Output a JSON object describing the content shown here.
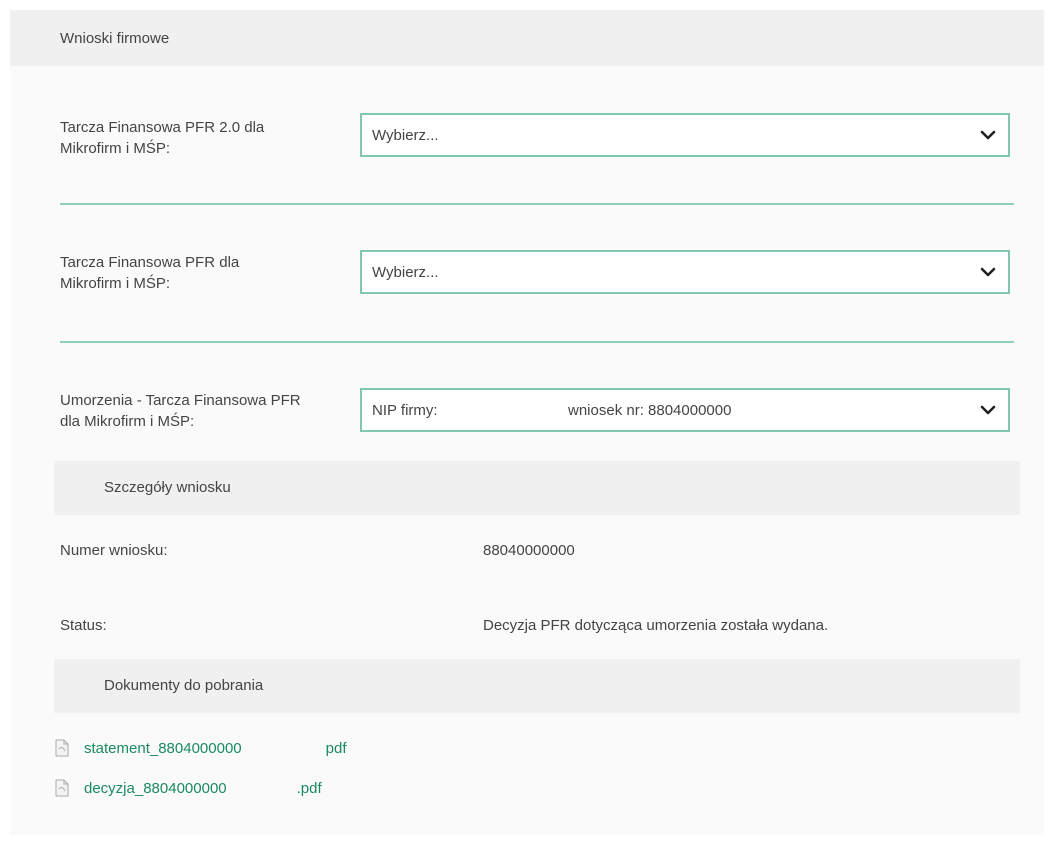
{
  "header": {
    "title": "Wnioski firmowe"
  },
  "fields": [
    {
      "label_line1": "Tarcza Finansowa PFR 2.0 dla",
      "label_line2": "Mikrofirm i MŚP:",
      "value": "Wybierz..."
    },
    {
      "label_line1": "Tarcza Finansowa PFR dla",
      "label_line2": "Mikrofirm i MŚP:",
      "value": "Wybierz..."
    },
    {
      "label_line1": "Umorzenia - Tarcza Finansowa PFR",
      "label_line2": "dla Mikrofirm i MŚP:",
      "value_nip": "NIP firmy:",
      "value_wniosek": "wniosek nr: 8804000000"
    }
  ],
  "details": {
    "section_title": "Szczegóły wniosku",
    "number_label": "Numer wniosku:",
    "number_value": "88040000000",
    "status_label": "Status:",
    "status_value": "Decyzja PFR dotycząca umorzenia została wydana."
  },
  "documents": {
    "section_title": "Dokumenty do pobrania",
    "files": [
      {
        "name_prefix": "statement_8804000000",
        "name_suffix": "pdf",
        "icon": "pdf-file-icon"
      },
      {
        "name_prefix": "decyzja_8804000000",
        "name_suffix": ".pdf",
        "icon": "pdf-file-icon"
      }
    ]
  },
  "colors": {
    "accent_border": "#7fc8ae",
    "link": "#1a8a60",
    "section_bg": "#f0f0f0"
  }
}
